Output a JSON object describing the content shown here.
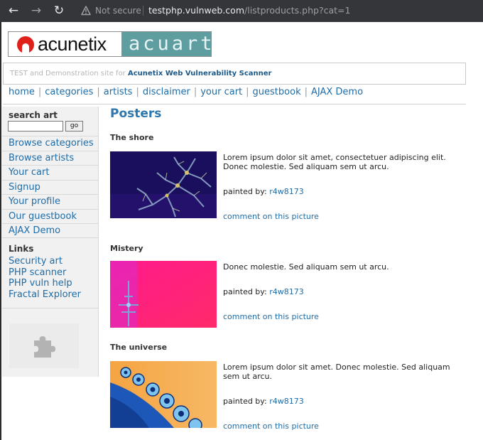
{
  "browser": {
    "security_label": "Not secure",
    "url_host": "testphp.vulnweb.com",
    "url_path": "/listproducts.php?cat=1"
  },
  "logo": {
    "brand": "acunetix",
    "product": "acuart"
  },
  "tagline": {
    "prefix": "TEST and Demonstration site for",
    "highlight": "Acunetix Web Vulnerability Scanner"
  },
  "topnav": [
    {
      "label": "home"
    },
    {
      "label": "categories"
    },
    {
      "label": "artists"
    },
    {
      "label": "disclaimer"
    },
    {
      "label": "your cart"
    },
    {
      "label": "guestbook"
    },
    {
      "label": "AJAX Demo"
    }
  ],
  "sidebar": {
    "search_title": "search art",
    "search_value": "",
    "search_button": "go",
    "nav": [
      {
        "label": "Browse categories"
      },
      {
        "label": "Browse artists"
      },
      {
        "label": "Your cart"
      },
      {
        "label": "Signup"
      },
      {
        "label": "Your profile"
      },
      {
        "label": "Our guestbook"
      },
      {
        "label": "AJAX Demo"
      }
    ],
    "links_title": "Links",
    "links": [
      {
        "label": "Security art"
      },
      {
        "label": "PHP scanner"
      },
      {
        "label": "PHP vuln help"
      },
      {
        "label": "Fractal Explorer"
      }
    ],
    "plugin_icon": "puzzle-piece-icon"
  },
  "main": {
    "title": "Posters",
    "painted_by_label": "painted by:",
    "items": [
      {
        "title": "The shore",
        "description": "Lorem ipsum dolor sit amet, consectetuer adipiscing elit. Donec molestie. Sed aliquam sem ut arcu.",
        "artist": "r4w8173",
        "comment_link": "comment on this picture"
      },
      {
        "title": "Mistery",
        "description": "Donec molestie. Sed aliquam sem ut arcu.",
        "artist": "r4w8173",
        "comment_link": "comment on this picture"
      },
      {
        "title": "The universe",
        "description": "Lorem ipsum dolor sit amet. Donec molestie. Sed aliquam sem ut arcu.",
        "artist": "r4w8173",
        "comment_link": "comment on this picture"
      }
    ]
  },
  "colors": {
    "link": "#1e6ca8",
    "heading": "#2c77ad",
    "browser_bar": "#35363a",
    "logo_red": "#e0201a",
    "logo_teal": "#5f9ea0"
  }
}
